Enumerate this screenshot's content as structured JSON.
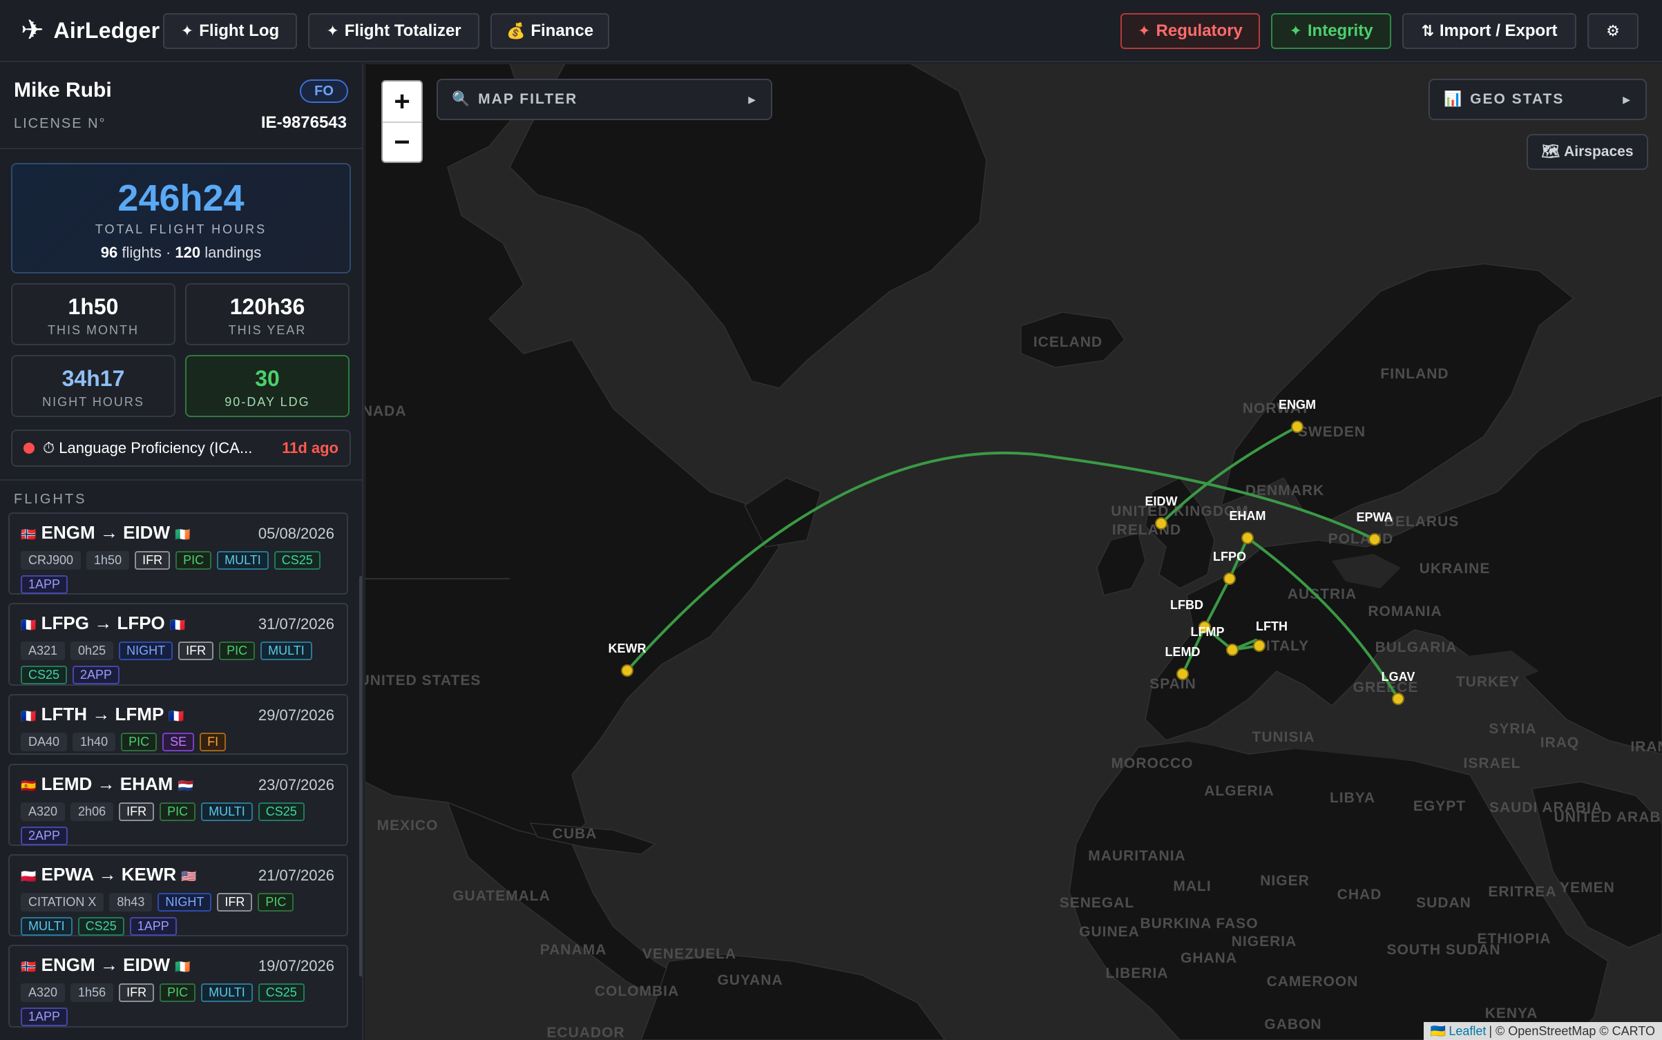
{
  "app": {
    "name": "AirLedger"
  },
  "nav": {
    "flight_log": "Flight Log",
    "flight_totalizer": "Flight Totalizer",
    "finance": "Finance",
    "regulatory": "Regulatory",
    "integrity": "Integrity",
    "import_export": "Import / Export"
  },
  "pilot": {
    "name": "Mike Rubi",
    "rank": "FO",
    "license_label": "LICENSE N°",
    "license_no": "IE-9876543"
  },
  "totals": {
    "hours": "246h24",
    "label": "TOTAL FLIGHT HOURS",
    "flights": "96",
    "flights_word": "flights",
    "landings": "120",
    "landings_word": "landings"
  },
  "stats": {
    "month": {
      "value": "1h50",
      "label": "THIS MONTH"
    },
    "year": {
      "value": "120h36",
      "label": "THIS YEAR"
    },
    "night": {
      "value": "34h17",
      "label": "NIGHT HOURS"
    },
    "ldg90": {
      "value": "30",
      "label": "90-DAY LDG"
    }
  },
  "alert": {
    "text": "⏱ Language Proficiency (ICA...",
    "ago": "11d ago"
  },
  "flights_title": "FLIGHTS",
  "flights": [
    {
      "from": "ENGM",
      "to": "EIDW",
      "from_flag": "🇳🇴",
      "to_flag": "🇮🇪",
      "date": "05/08/2026",
      "tags": [
        {
          "t": "CRJ900",
          "k": "ac"
        },
        {
          "t": "1h50",
          "k": "ac"
        },
        {
          "t": "IFR",
          "k": "ifr"
        },
        {
          "t": "PIC",
          "k": "pic"
        },
        {
          "t": "MULTI",
          "k": "multi"
        },
        {
          "t": "CS25",
          "k": "cs25"
        },
        {
          "t": "1APP",
          "k": "app"
        }
      ]
    },
    {
      "from": "LFPG",
      "to": "LFPO",
      "from_flag": "🇫🇷",
      "to_flag": "🇫🇷",
      "date": "31/07/2026",
      "tags": [
        {
          "t": "A321",
          "k": "ac"
        },
        {
          "t": "0h25",
          "k": "ac"
        },
        {
          "t": "NIGHT",
          "k": "night"
        },
        {
          "t": "IFR",
          "k": "ifr"
        },
        {
          "t": "PIC",
          "k": "pic"
        },
        {
          "t": "MULTI",
          "k": "multi"
        },
        {
          "t": "CS25",
          "k": "cs25"
        },
        {
          "t": "2APP",
          "k": "app"
        }
      ]
    },
    {
      "from": "LFTH",
      "to": "LFMP",
      "from_flag": "🇫🇷",
      "to_flag": "🇫🇷",
      "date": "29/07/2026",
      "tags": [
        {
          "t": "DA40",
          "k": "ac"
        },
        {
          "t": "1h40",
          "k": "ac"
        },
        {
          "t": "PIC",
          "k": "pic"
        },
        {
          "t": "SE",
          "k": "se"
        },
        {
          "t": "FI",
          "k": "fi"
        }
      ]
    },
    {
      "from": "LEMD",
      "to": "EHAM",
      "from_flag": "🇪🇸",
      "to_flag": "🇳🇱",
      "date": "23/07/2026",
      "tags": [
        {
          "t": "A320",
          "k": "ac"
        },
        {
          "t": "2h06",
          "k": "ac"
        },
        {
          "t": "IFR",
          "k": "ifr"
        },
        {
          "t": "PIC",
          "k": "pic"
        },
        {
          "t": "MULTI",
          "k": "multi"
        },
        {
          "t": "CS25",
          "k": "cs25"
        },
        {
          "t": "2APP",
          "k": "app"
        }
      ]
    },
    {
      "from": "EPWA",
      "to": "KEWR",
      "from_flag": "🇵🇱",
      "to_flag": "🇺🇸",
      "date": "21/07/2026",
      "tags": [
        {
          "t": "CITATION X",
          "k": "ac"
        },
        {
          "t": "8h43",
          "k": "ac"
        },
        {
          "t": "NIGHT",
          "k": "night"
        },
        {
          "t": "IFR",
          "k": "ifr"
        },
        {
          "t": "PIC",
          "k": "pic"
        },
        {
          "t": "MULTI",
          "k": "multi"
        },
        {
          "t": "CS25",
          "k": "cs25"
        },
        {
          "t": "1APP",
          "k": "app"
        }
      ]
    },
    {
      "from": "ENGM",
      "to": "EIDW",
      "from_flag": "🇳🇴",
      "to_flag": "🇮🇪",
      "date": "19/07/2026",
      "tags": [
        {
          "t": "A320",
          "k": "ac"
        },
        {
          "t": "1h56",
          "k": "ac"
        },
        {
          "t": "IFR",
          "k": "ifr"
        },
        {
          "t": "PIC",
          "k": "pic"
        },
        {
          "t": "MULTI",
          "k": "multi"
        },
        {
          "t": "CS25",
          "k": "cs25"
        },
        {
          "t": "1APP",
          "k": "app"
        }
      ]
    }
  ],
  "map": {
    "filter_label": "MAP FILTER",
    "geo_stats_label": "GEO STATS",
    "airspaces_label": "Airspaces",
    "zoom_in": "+",
    "zoom_out": "−",
    "attribution_leaflet": "Leaflet",
    "attribution_rest": "| © OpenStreetMap © CARTO",
    "route_color": "#3a9a45",
    "airport_color": "#e8c21a",
    "airports": [
      "KEWR",
      "EIDW",
      "ENGM",
      "EHAM",
      "EPWA",
      "LFPO",
      "LFBD",
      "LFMP",
      "LFTH",
      "LEMD",
      "LGAV"
    ],
    "country_labels": [
      "ICELAND",
      "FINLAND",
      "NORWAY",
      "SWEDEN",
      "DENMARK",
      "UNITED KINGDOM",
      "IRELAND",
      "BELARUS",
      "POLAND",
      "UKRAINE",
      "AUSTRIA",
      "ROMANIA",
      "ITALY",
      "BULGARIA",
      "SPAIN",
      "GREECE",
      "TURKEY",
      "TUNISIA",
      "MOROCCO",
      "ALGERIA",
      "LIBYA",
      "EGYPT",
      "SYRIA",
      "IRAQ",
      "IRAN",
      "ISRAEL",
      "SAUDI ARABIA",
      "UNITED ARAB EMIRATES",
      "MAURITANIA",
      "MALI",
      "NIGER",
      "CHAD",
      "SUDAN",
      "ERITREA",
      "YEMEN",
      "ETHIOPIA",
      "SOUTH SUDAN",
      "SENEGAL",
      "GUINEA",
      "BURKINA FASO",
      "NIGERIA",
      "GHANA",
      "LIBERIA",
      "CAMEROON",
      "GABON",
      "KENYA",
      "UNITED STATES",
      "MEXICO",
      "CUBA",
      "GUATEMALA",
      "PANAMA",
      "VENEZUELA",
      "GUYANA",
      "COLOMBIA",
      "ECUADOR",
      "CANADA"
    ]
  }
}
